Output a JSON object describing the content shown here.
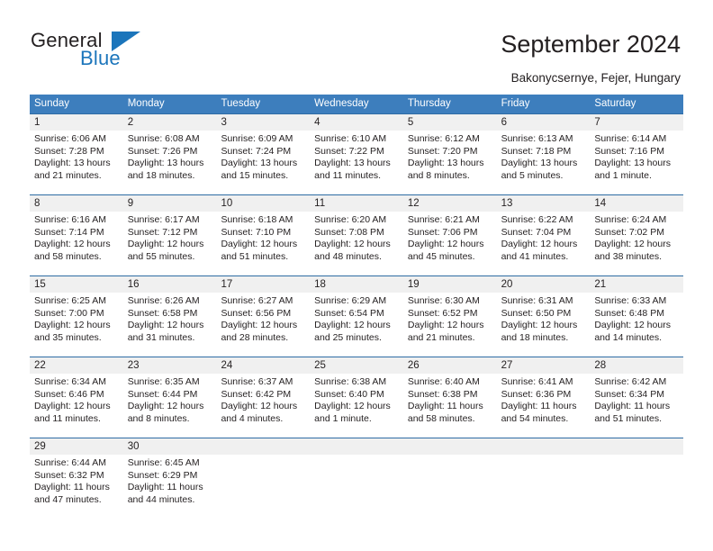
{
  "brand": {
    "word1": "General",
    "word2": "Blue",
    "logo_icon": "blue-triangle-icon",
    "accent_color": "#1b75bb"
  },
  "header": {
    "title": "September 2024",
    "subtitle": "Bakonycsernye, Fejer, Hungary"
  },
  "calendar": {
    "header_bg": "#3d7ebd",
    "daynum_bg": "#f0f0f0",
    "weekdays": [
      "Sunday",
      "Monday",
      "Tuesday",
      "Wednesday",
      "Thursday",
      "Friday",
      "Saturday"
    ],
    "weeks": [
      [
        {
          "day": "1",
          "sunrise": "Sunrise: 6:06 AM",
          "sunset": "Sunset: 7:28 PM",
          "daylight": "Daylight: 13 hours and 21 minutes."
        },
        {
          "day": "2",
          "sunrise": "Sunrise: 6:08 AM",
          "sunset": "Sunset: 7:26 PM",
          "daylight": "Daylight: 13 hours and 18 minutes."
        },
        {
          "day": "3",
          "sunrise": "Sunrise: 6:09 AM",
          "sunset": "Sunset: 7:24 PM",
          "daylight": "Daylight: 13 hours and 15 minutes."
        },
        {
          "day": "4",
          "sunrise": "Sunrise: 6:10 AM",
          "sunset": "Sunset: 7:22 PM",
          "daylight": "Daylight: 13 hours and 11 minutes."
        },
        {
          "day": "5",
          "sunrise": "Sunrise: 6:12 AM",
          "sunset": "Sunset: 7:20 PM",
          "daylight": "Daylight: 13 hours and 8 minutes."
        },
        {
          "day": "6",
          "sunrise": "Sunrise: 6:13 AM",
          "sunset": "Sunset: 7:18 PM",
          "daylight": "Daylight: 13 hours and 5 minutes."
        },
        {
          "day": "7",
          "sunrise": "Sunrise: 6:14 AM",
          "sunset": "Sunset: 7:16 PM",
          "daylight": "Daylight: 13 hours and 1 minute."
        }
      ],
      [
        {
          "day": "8",
          "sunrise": "Sunrise: 6:16 AM",
          "sunset": "Sunset: 7:14 PM",
          "daylight": "Daylight: 12 hours and 58 minutes."
        },
        {
          "day": "9",
          "sunrise": "Sunrise: 6:17 AM",
          "sunset": "Sunset: 7:12 PM",
          "daylight": "Daylight: 12 hours and 55 minutes."
        },
        {
          "day": "10",
          "sunrise": "Sunrise: 6:18 AM",
          "sunset": "Sunset: 7:10 PM",
          "daylight": "Daylight: 12 hours and 51 minutes."
        },
        {
          "day": "11",
          "sunrise": "Sunrise: 6:20 AM",
          "sunset": "Sunset: 7:08 PM",
          "daylight": "Daylight: 12 hours and 48 minutes."
        },
        {
          "day": "12",
          "sunrise": "Sunrise: 6:21 AM",
          "sunset": "Sunset: 7:06 PM",
          "daylight": "Daylight: 12 hours and 45 minutes."
        },
        {
          "day": "13",
          "sunrise": "Sunrise: 6:22 AM",
          "sunset": "Sunset: 7:04 PM",
          "daylight": "Daylight: 12 hours and 41 minutes."
        },
        {
          "day": "14",
          "sunrise": "Sunrise: 6:24 AM",
          "sunset": "Sunset: 7:02 PM",
          "daylight": "Daylight: 12 hours and 38 minutes."
        }
      ],
      [
        {
          "day": "15",
          "sunrise": "Sunrise: 6:25 AM",
          "sunset": "Sunset: 7:00 PM",
          "daylight": "Daylight: 12 hours and 35 minutes."
        },
        {
          "day": "16",
          "sunrise": "Sunrise: 6:26 AM",
          "sunset": "Sunset: 6:58 PM",
          "daylight": "Daylight: 12 hours and 31 minutes."
        },
        {
          "day": "17",
          "sunrise": "Sunrise: 6:27 AM",
          "sunset": "Sunset: 6:56 PM",
          "daylight": "Daylight: 12 hours and 28 minutes."
        },
        {
          "day": "18",
          "sunrise": "Sunrise: 6:29 AM",
          "sunset": "Sunset: 6:54 PM",
          "daylight": "Daylight: 12 hours and 25 minutes."
        },
        {
          "day": "19",
          "sunrise": "Sunrise: 6:30 AM",
          "sunset": "Sunset: 6:52 PM",
          "daylight": "Daylight: 12 hours and 21 minutes."
        },
        {
          "day": "20",
          "sunrise": "Sunrise: 6:31 AM",
          "sunset": "Sunset: 6:50 PM",
          "daylight": "Daylight: 12 hours and 18 minutes."
        },
        {
          "day": "21",
          "sunrise": "Sunrise: 6:33 AM",
          "sunset": "Sunset: 6:48 PM",
          "daylight": "Daylight: 12 hours and 14 minutes."
        }
      ],
      [
        {
          "day": "22",
          "sunrise": "Sunrise: 6:34 AM",
          "sunset": "Sunset: 6:46 PM",
          "daylight": "Daylight: 12 hours and 11 minutes."
        },
        {
          "day": "23",
          "sunrise": "Sunrise: 6:35 AM",
          "sunset": "Sunset: 6:44 PM",
          "daylight": "Daylight: 12 hours and 8 minutes."
        },
        {
          "day": "24",
          "sunrise": "Sunrise: 6:37 AM",
          "sunset": "Sunset: 6:42 PM",
          "daylight": "Daylight: 12 hours and 4 minutes."
        },
        {
          "day": "25",
          "sunrise": "Sunrise: 6:38 AM",
          "sunset": "Sunset: 6:40 PM",
          "daylight": "Daylight: 12 hours and 1 minute."
        },
        {
          "day": "26",
          "sunrise": "Sunrise: 6:40 AM",
          "sunset": "Sunset: 6:38 PM",
          "daylight": "Daylight: 11 hours and 58 minutes."
        },
        {
          "day": "27",
          "sunrise": "Sunrise: 6:41 AM",
          "sunset": "Sunset: 6:36 PM",
          "daylight": "Daylight: 11 hours and 54 minutes."
        },
        {
          "day": "28",
          "sunrise": "Sunrise: 6:42 AM",
          "sunset": "Sunset: 6:34 PM",
          "daylight": "Daylight: 11 hours and 51 minutes."
        }
      ],
      [
        {
          "day": "29",
          "sunrise": "Sunrise: 6:44 AM",
          "sunset": "Sunset: 6:32 PM",
          "daylight": "Daylight: 11 hours and 47 minutes."
        },
        {
          "day": "30",
          "sunrise": "Sunrise: 6:45 AM",
          "sunset": "Sunset: 6:29 PM",
          "daylight": "Daylight: 11 hours and 44 minutes."
        },
        {
          "day": "",
          "sunrise": "",
          "sunset": "",
          "daylight": ""
        },
        {
          "day": "",
          "sunrise": "",
          "sunset": "",
          "daylight": ""
        },
        {
          "day": "",
          "sunrise": "",
          "sunset": "",
          "daylight": ""
        },
        {
          "day": "",
          "sunrise": "",
          "sunset": "",
          "daylight": ""
        },
        {
          "day": "",
          "sunrise": "",
          "sunset": "",
          "daylight": ""
        }
      ]
    ]
  }
}
